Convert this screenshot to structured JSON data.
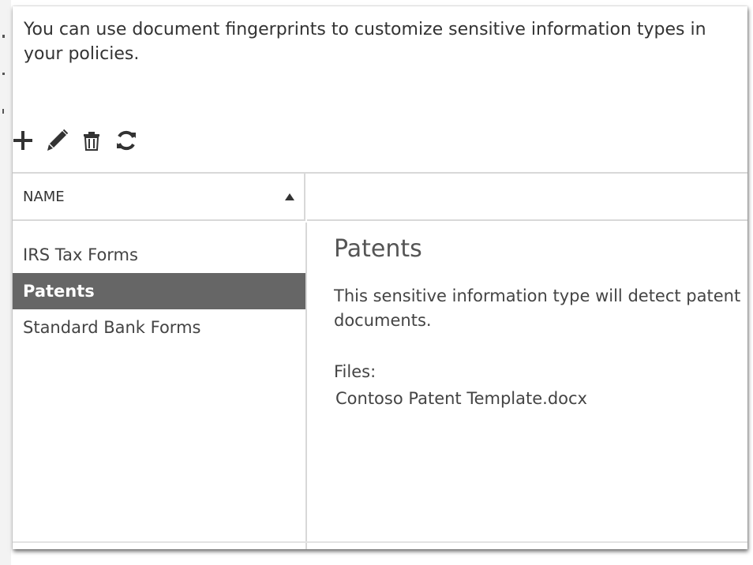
{
  "intro_text": "You can use document fingerprints to customize sensitive information types in your policies.",
  "toolbar": {
    "add_icon": "plus-icon",
    "edit_icon": "pencil-icon",
    "delete_icon": "trash-icon",
    "refresh_icon": "refresh-icon"
  },
  "table": {
    "column_header": "NAME",
    "sort": "ascending"
  },
  "list": {
    "items": [
      {
        "label": "IRS Tax Forms",
        "selected": false
      },
      {
        "label": "Patents",
        "selected": true
      },
      {
        "label": "Standard Bank Forms",
        "selected": false
      }
    ]
  },
  "detail": {
    "title": "Patents",
    "description": "This sensitive information type will detect patent documents.",
    "files_label": "Files:",
    "files": [
      "Contoso Patent Template.docx"
    ]
  },
  "colors": {
    "selected_row_bg": "#666666",
    "selected_row_text": "#ffffff",
    "border": "#d8d8d8",
    "icon": "#333333"
  }
}
